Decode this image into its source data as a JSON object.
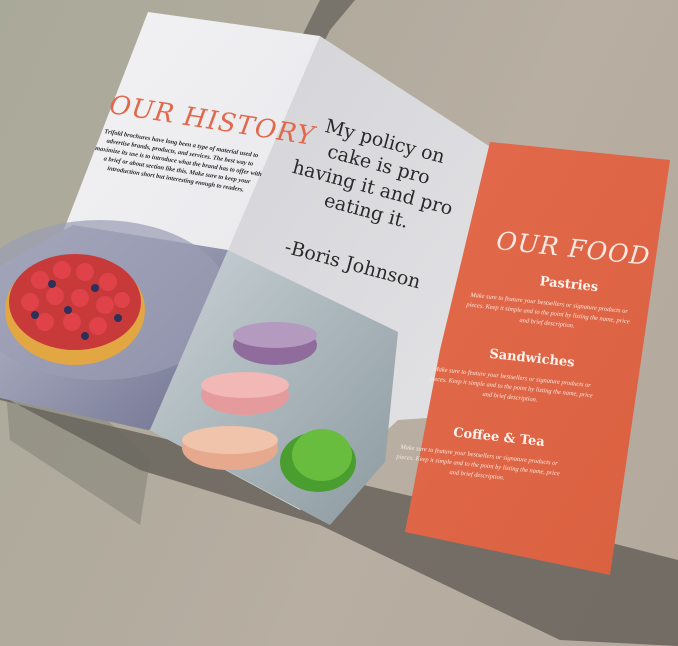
{
  "brochure": {
    "history": {
      "title": "OUR HISTORY",
      "body": "Trifold brochures have long been a type of material used to advertise brands, products, and services. The best way to maximize its use is to introduce what the brand has to offer with a brief or about section like this. Make sure to keep your introduction short but interesting enough to readers."
    },
    "quote": {
      "text": "My policy on cake is pro having it and pro eating it.",
      "author": "-Boris Johnson"
    },
    "food": {
      "title": "OUR FOOD",
      "sections": [
        {
          "heading": "Pastries",
          "body": "Make sure to feature your bestsellers or signature products or pieces. Keep it simple and to the point by listing the name, price and brief description."
        },
        {
          "heading": "Sandwiches",
          "body": "Make sure to feature your bestsellers or signature products or pieces. Keep it simple and to the point by listing the name, price and brief description."
        },
        {
          "heading": "Coffee & Tea",
          "body": "Make sure to feature your bestsellers or signature products or pieces. Keep it simple and to the point by listing the name, price and brief description."
        }
      ]
    },
    "colors": {
      "accent": "#e2684c",
      "panel_orange": "#e0674a",
      "panel_light": "#eeeef0",
      "background": "#b5aa9e"
    }
  }
}
